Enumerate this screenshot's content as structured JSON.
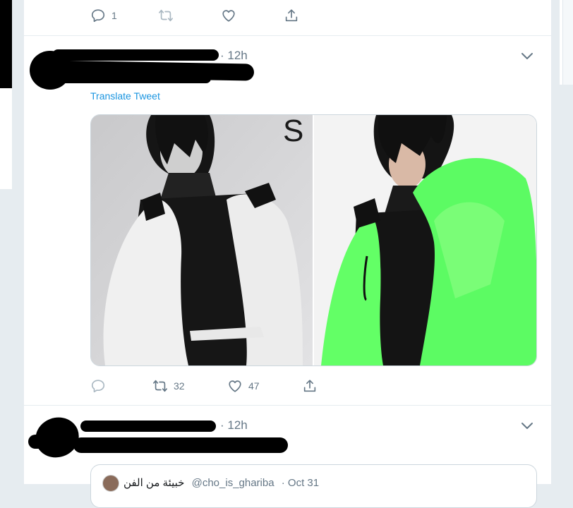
{
  "tweet_top": {
    "reply_count": "1",
    "retweet_count": "",
    "like_count": ""
  },
  "tweet_main": {
    "time": "· 12h",
    "translate_label": "Translate Tweet",
    "image_text": "S",
    "reply_count": "",
    "retweet_count": "32",
    "like_count": "47"
  },
  "tweet_bottom": {
    "time": "· 12h",
    "quote": {
      "author": "خبيئة من الفن",
      "handle": "@cho_is_ghariba",
      "time": "· Oct 31"
    }
  },
  "colors": {
    "accent": "#1b95e0",
    "muted": "#657786",
    "divider": "#e6ecf0",
    "retweet_green": "#17bf63",
    "fur_green": "#6dff6a"
  },
  "icons": {
    "reply": "reply-icon",
    "retweet": "retweet-icon",
    "like": "heart-icon",
    "share": "share-icon",
    "more": "chevron-down-icon"
  }
}
